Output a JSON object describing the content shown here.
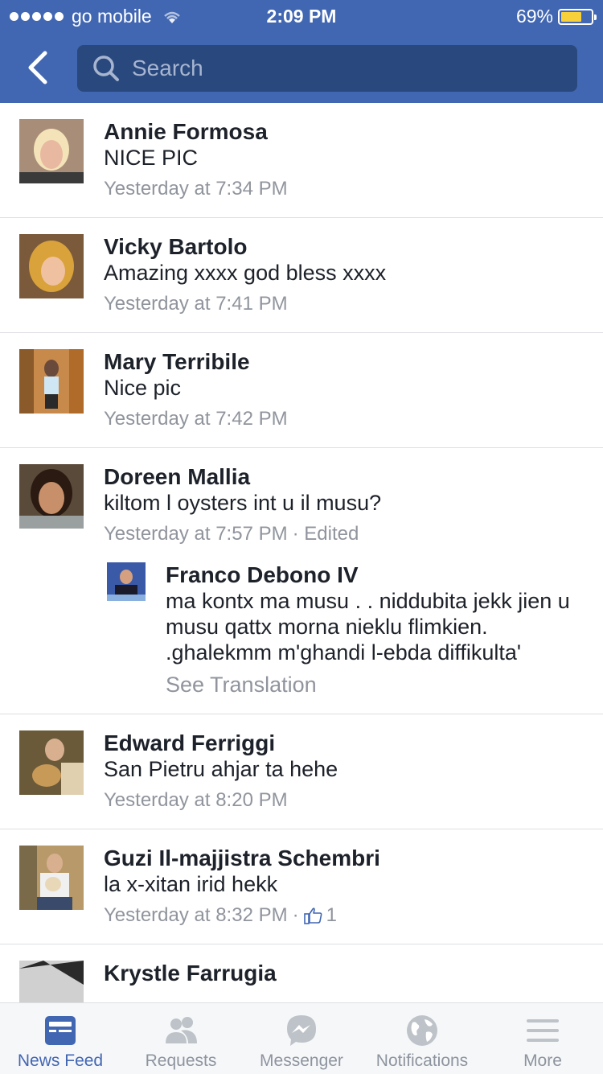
{
  "status_bar": {
    "carrier": "go mobile",
    "time": "2:09 PM",
    "battery": "69%",
    "battery_level": 0.69
  },
  "header": {
    "search_placeholder": "Search",
    "back_icon": "chevron-left-icon",
    "search_icon": "search-icon"
  },
  "comments": [
    {
      "name": "Annie Formosa",
      "text": "NICE PIC",
      "time": "Yesterday at 7:34 PM"
    },
    {
      "name": "Vicky Bartolo",
      "text": "Amazing xxxx god bless xxxx",
      "time": "Yesterday at 7:41 PM"
    },
    {
      "name": "Mary Terribile",
      "text": "Nice pic",
      "time": "Yesterday at 7:42 PM"
    },
    {
      "name": "Doreen Mallia",
      "text": "kiltom l oysters int u il musu?",
      "time": "Yesterday at 7:57 PM",
      "edited": "· Edited"
    },
    {
      "name": "Edward Ferriggi",
      "text": "San Pietru ahjar ta hehe",
      "time": "Yesterday at 8:20 PM"
    },
    {
      "name": "Guzi Il-majjistra Schembri",
      "text": "la x-xitan irid hekk",
      "time": "Yesterday at 8:32 PM",
      "separator": "·",
      "likes": "1"
    },
    {
      "name": "Krystle Farrugia"
    }
  ],
  "reply": {
    "name": "Franco Debono IV",
    "text": "ma kontx ma musu  . . niddubita jekk jien u musu qattx morna nieklu flimkien. .ghalekmm m'ghandi l-ebda diffikulta'",
    "see_translation": "See Translation"
  },
  "tabs": [
    {
      "label": "News Feed",
      "icon": "news-feed-icon",
      "active": true
    },
    {
      "label": "Requests",
      "icon": "friend-requests-icon"
    },
    {
      "label": "Messenger",
      "icon": "messenger-icon"
    },
    {
      "label": "Notifications",
      "icon": "globe-icon"
    },
    {
      "label": "More",
      "icon": "menu-icon"
    }
  ],
  "colors": {
    "brand": "#4267b2",
    "search_field": "#29487d",
    "meta_text": "#90949c",
    "divider": "#dddfe2"
  }
}
